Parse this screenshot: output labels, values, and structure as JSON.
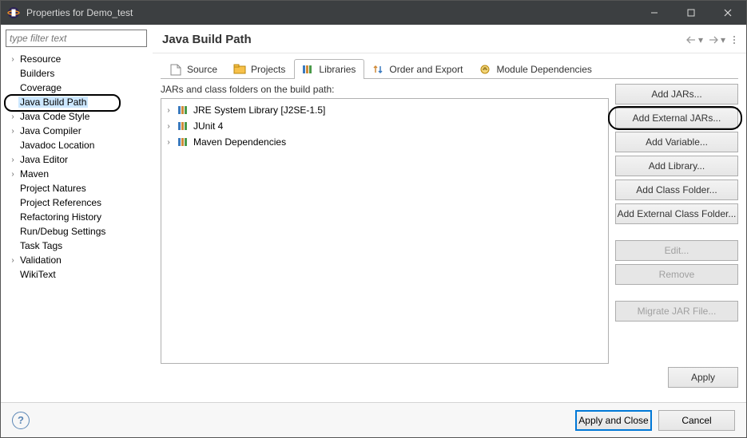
{
  "window": {
    "title": "Properties for Demo_test"
  },
  "filter": {
    "placeholder": "type filter text"
  },
  "nav": {
    "items": [
      {
        "label": "Resource",
        "expandable": true
      },
      {
        "label": "Builders",
        "expandable": false
      },
      {
        "label": "Coverage",
        "expandable": false
      },
      {
        "label": "Java Build Path",
        "expandable": false,
        "selected": true,
        "circled": true
      },
      {
        "label": "Java Code Style",
        "expandable": true
      },
      {
        "label": "Java Compiler",
        "expandable": true
      },
      {
        "label": "Javadoc Location",
        "expandable": false
      },
      {
        "label": "Java Editor",
        "expandable": true
      },
      {
        "label": "Maven",
        "expandable": true
      },
      {
        "label": "Project Natures",
        "expandable": false
      },
      {
        "label": "Project References",
        "expandable": false
      },
      {
        "label": "Refactoring History",
        "expandable": false
      },
      {
        "label": "Run/Debug Settings",
        "expandable": false
      },
      {
        "label": "Task Tags",
        "expandable": false
      },
      {
        "label": "Validation",
        "expandable": true
      },
      {
        "label": "WikiText",
        "expandable": false
      }
    ]
  },
  "page": {
    "title": "Java Build Path",
    "tabs": [
      {
        "label": "Source"
      },
      {
        "label": "Projects"
      },
      {
        "label": "Libraries",
        "active": true
      },
      {
        "label": "Order and Export"
      },
      {
        "label": "Module Dependencies"
      }
    ],
    "libs_desc": "JARs and class folders on the build path:",
    "libs": [
      {
        "label": "JRE System Library [J2SE-1.5]"
      },
      {
        "label": "JUnit 4"
      },
      {
        "label": "Maven Dependencies"
      }
    ],
    "buttons": {
      "add_jars": "Add JARs...",
      "add_external_jars": "Add External JARs...",
      "add_variable": "Add Variable...",
      "add_library": "Add Library...",
      "add_class_folder": "Add Class Folder...",
      "add_ext_class_folder": "Add External Class Folder...",
      "edit": "Edit...",
      "remove": "Remove",
      "migrate": "Migrate JAR File..."
    },
    "apply": "Apply"
  },
  "footer": {
    "apply_close": "Apply and Close",
    "cancel": "Cancel"
  }
}
